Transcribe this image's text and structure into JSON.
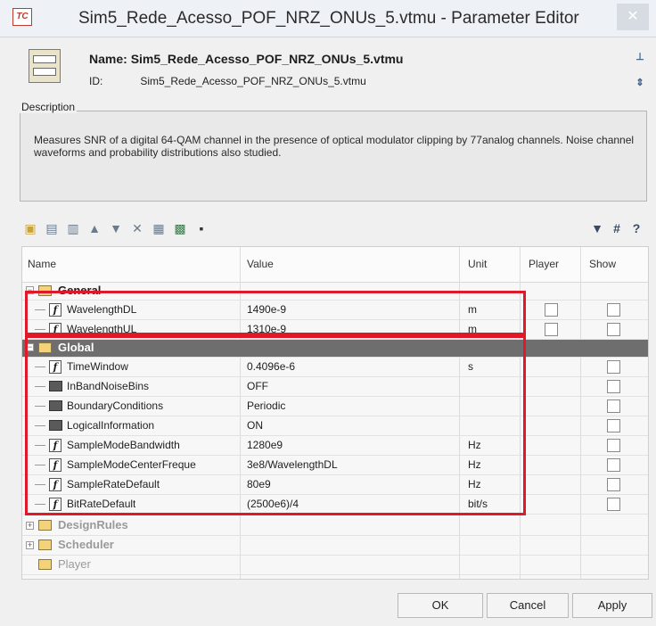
{
  "window": {
    "app_icon_text": "TC",
    "title": "Sim5_Rede_Acesso_POF_NRZ_ONUs_5.vtmu - Parameter Editor",
    "close_glyph": "✕"
  },
  "header": {
    "name_label": "Name:",
    "name_value": "Sim5_Rede_Acesso_POF_NRZ_ONUs_5.vtmu",
    "id_label": "ID:",
    "id_value": "Sim5_Rede_Acesso_POF_NRZ_ONUs_5.vtmu"
  },
  "description": {
    "label": "Description",
    "text": "Measures SNR of a digital 64-QAM channel in the presence of optical modulator clipping by 77analog channels. Noise channel waveforms and probability distributions also studied."
  },
  "table": {
    "columns": {
      "name": "Name",
      "value": "Value",
      "unit": "Unit",
      "player": "Player",
      "show": "Show"
    },
    "groups": {
      "general": "General",
      "global": "Global",
      "design_rules": "DesignRules",
      "scheduler": "Scheduler",
      "player": "Player"
    },
    "general_rows": [
      {
        "name": "WavelengthDL",
        "value": "1490e-9",
        "unit": "m"
      },
      {
        "name": "WavelengthUL",
        "value": "1310e-9",
        "unit": "m"
      }
    ],
    "global_rows": [
      {
        "name": "TimeWindow",
        "value": "0.4096e-6",
        "unit": "s"
      },
      {
        "name": "InBandNoiseBins",
        "value": "OFF",
        "unit": ""
      },
      {
        "name": "BoundaryConditions",
        "value": "Periodic",
        "unit": ""
      },
      {
        "name": "LogicalInformation",
        "value": "ON",
        "unit": ""
      },
      {
        "name": "SampleModeBandwidth",
        "value": "1280e9",
        "unit": "Hz"
      },
      {
        "name": "SampleModeCenterFreque",
        "value": "3e8/WavelengthDL",
        "unit": "Hz"
      },
      {
        "name": "SampleRateDefault",
        "value": "80e9",
        "unit": "Hz"
      },
      {
        "name": "BitRateDefault",
        "value": "(2500e6)/4",
        "unit": "bit/s"
      }
    ]
  },
  "buttons": {
    "ok": "OK",
    "cancel": "Cancel",
    "apply": "Apply"
  }
}
